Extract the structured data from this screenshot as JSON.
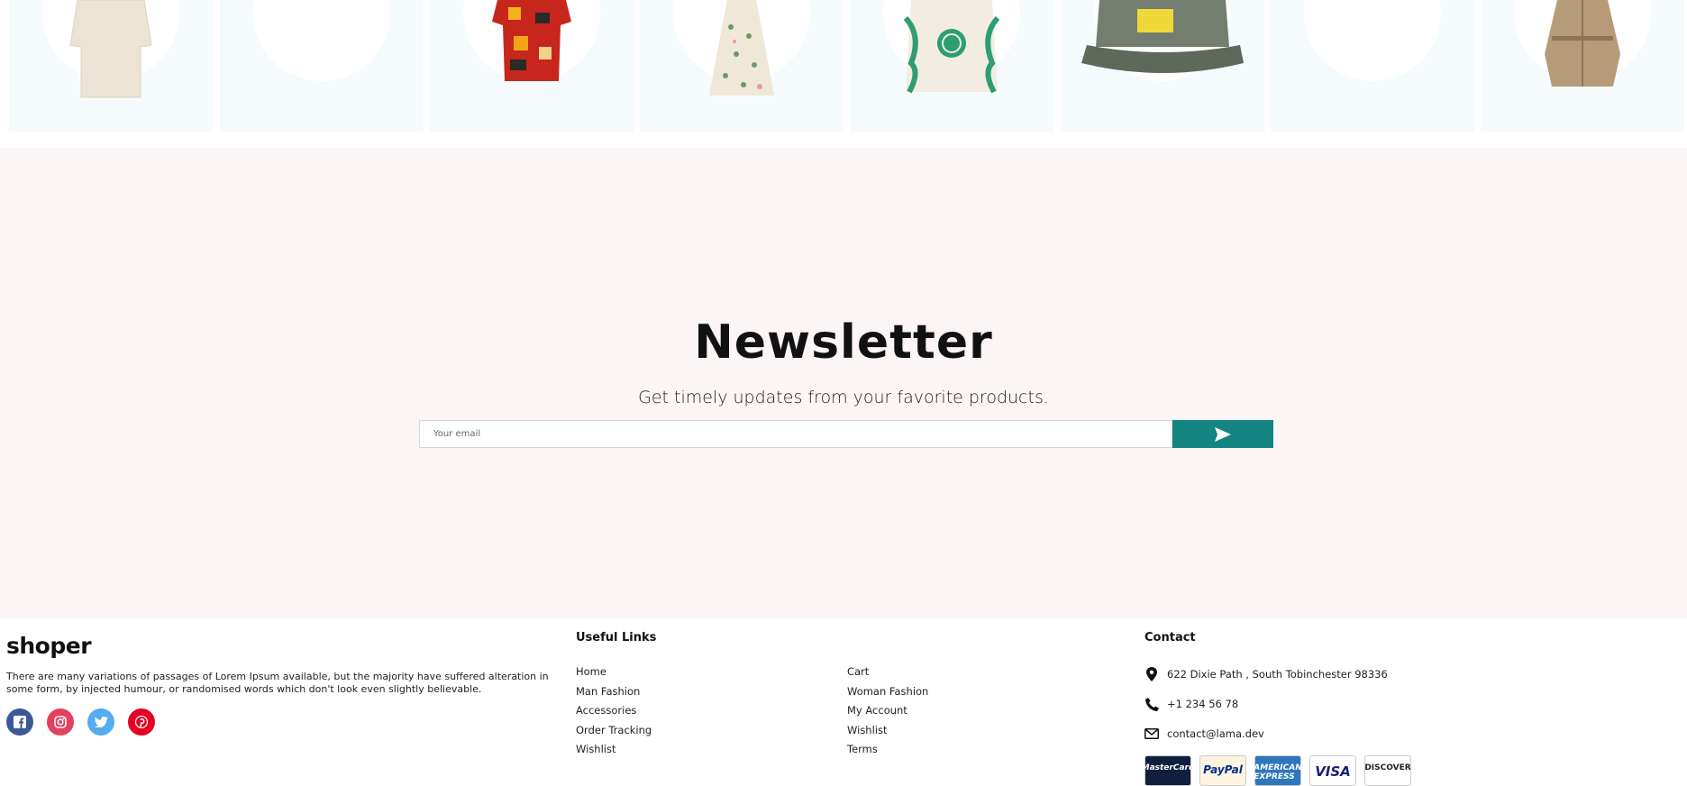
{
  "products": [
    {
      "name": "t-shirt"
    },
    {
      "name": "empty"
    },
    {
      "name": "hawaiian-shirt"
    },
    {
      "name": "floral-dress"
    },
    {
      "name": "tote-bag"
    },
    {
      "name": "cap"
    },
    {
      "name": "empty"
    },
    {
      "name": "trench-coat"
    }
  ],
  "newsletter": {
    "title": "Newsletter",
    "description": "Get timely updates from your favorite products.",
    "email_placeholder": "Your email",
    "send_icon": "send-icon"
  },
  "footer": {
    "logo": "shoper",
    "about": "There are many variations of passages of Lorem Ipsum available, but the majority have suffered alteration in some form, by injected humour, or randomised words which don't look even slightly believable.",
    "socials": [
      "facebook-icon",
      "instagram-icon",
      "twitter-icon",
      "pinterest-icon"
    ],
    "useful_links": {
      "title": "Useful Links",
      "col1": [
        "Home",
        "Man Fashion",
        "Accessories",
        "Order Tracking",
        "Wishlist"
      ],
      "col2": [
        "Cart",
        "Woman Fashion",
        "My Account",
        "Wishlist",
        "Terms"
      ]
    },
    "contact": {
      "title": "Contact",
      "address": "622 Dixie Path , South Tobinchester 98336",
      "phone": "+1 234 56 78",
      "email": "contact@lama.dev"
    },
    "payments": [
      "MasterCard",
      "PayPal",
      "AMERICAN EXPRESS",
      "VISA",
      "DISCOVER"
    ]
  },
  "colors": {
    "accent": "#148582",
    "newsletter_bg": "#fcf5f5",
    "product_bg": "#f5fbfd"
  }
}
